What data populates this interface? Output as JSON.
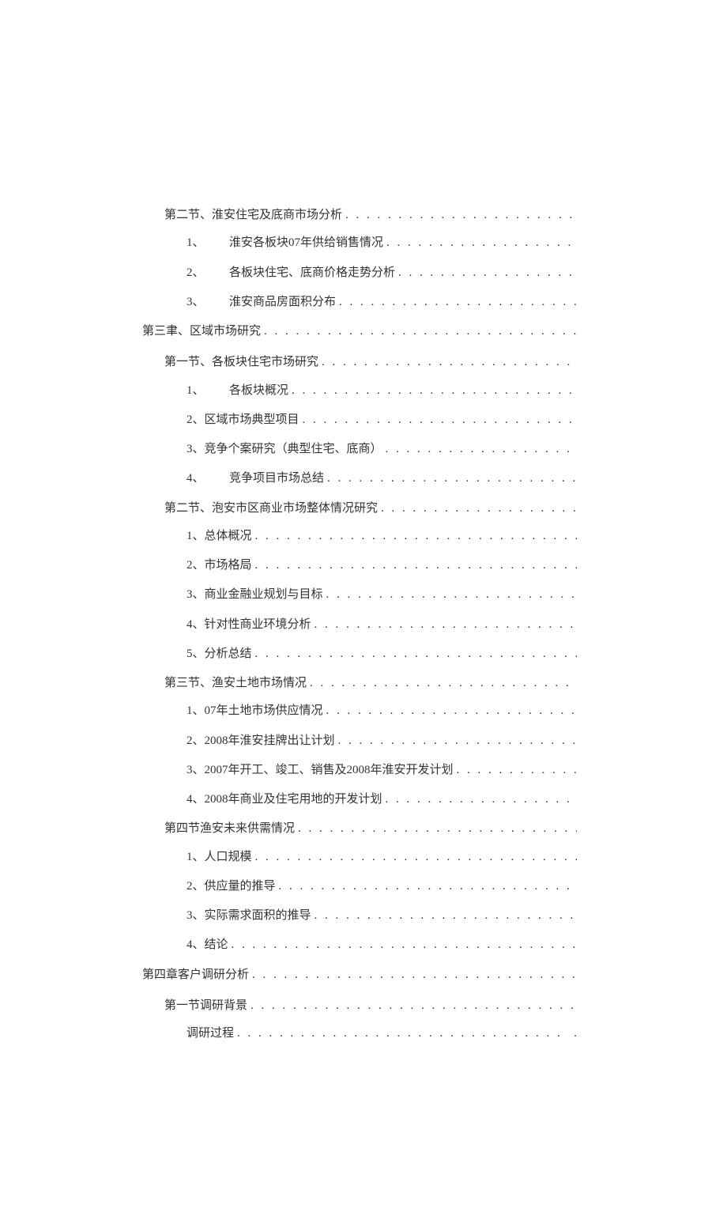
{
  "toc": {
    "entries": [
      {
        "level": "section",
        "text": "第二节、淮安住宅及底商市场分析"
      },
      {
        "level": "sub",
        "numSpaced": "1、",
        "text": "淮安各板块07年供给销售情况"
      },
      {
        "level": "sub",
        "numSpaced": "2、",
        "text": "各板块住宅、底商价格走势分析"
      },
      {
        "level": "sub",
        "numSpaced": "3、",
        "text": "淮安商品房面积分布"
      },
      {
        "level": "chapter",
        "text": "第三聿、区域市场研究"
      },
      {
        "level": "section",
        "text": "第一节、各板块住宅市场研究"
      },
      {
        "level": "sub",
        "numSpaced": "1、",
        "text": "各板块概况"
      },
      {
        "level": "sub",
        "text": "2、区域市场典型项目"
      },
      {
        "level": "sub",
        "text": "3、竞争个案研究（典型住宅、底商）"
      },
      {
        "level": "sub",
        "numSpaced": "4、",
        "text": "竞争项目市场总结"
      },
      {
        "level": "section",
        "text": "第二节、泡安市区商业市场整体情况研究"
      },
      {
        "level": "sub",
        "text": "1、总体概况"
      },
      {
        "level": "sub",
        "text": "2、市场格局"
      },
      {
        "level": "sub",
        "text": "3、商业金融业规划与目标"
      },
      {
        "level": "sub",
        "text": "4、针对性商业环境分析"
      },
      {
        "level": "sub",
        "text": "5、分析总结"
      },
      {
        "level": "section",
        "text": "第三节、渔安土地市场情况"
      },
      {
        "level": "sub",
        "text": "1、07年土地市场供应情况"
      },
      {
        "level": "sub",
        "text": "2、2008年淮安挂牌出让计划"
      },
      {
        "level": "sub",
        "text": "3、2007年开工、竣工、销售及2008年淮安开发计划"
      },
      {
        "level": "sub",
        "text": "4、2008年商业及住宅用地的开发计划"
      },
      {
        "level": "section",
        "text": "第四节渔安未来供需情况"
      },
      {
        "level": "sub",
        "text": "1、人口规模"
      },
      {
        "level": "sub",
        "text": "2、供应量的推导"
      },
      {
        "level": "sub",
        "text": "3、实际需求面积的推导"
      },
      {
        "level": "sub",
        "text": "4、结论"
      },
      {
        "level": "chapter",
        "text": "第四章客户调研分析"
      },
      {
        "level": "section",
        "text": "第一节调研背景"
      },
      {
        "level": "sub",
        "text": "调研过程",
        "trailingDot": "."
      }
    ]
  }
}
